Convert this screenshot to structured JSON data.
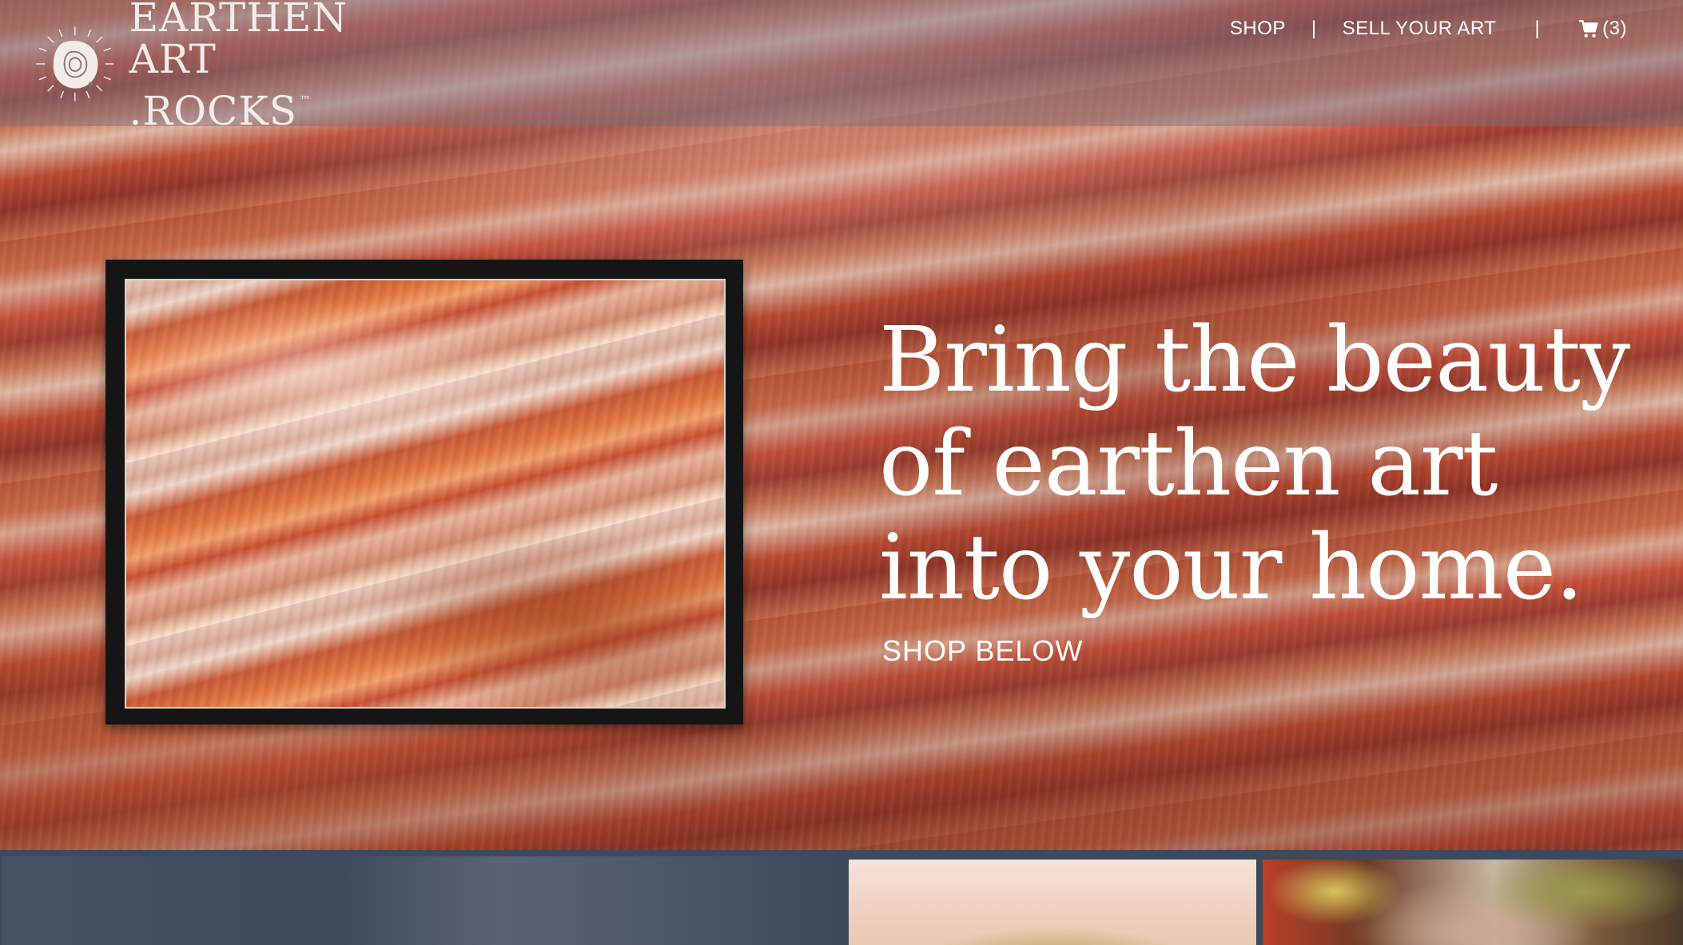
{
  "brand": {
    "line1": "EARTHEN ART",
    "line2": ".ROCKS",
    "trademark": "™",
    "icon": "geode-sun-icon"
  },
  "nav": {
    "shop": "SHOP",
    "separator": "|",
    "sell": "SELL YOUR ART",
    "cart_icon": "cart-icon",
    "cart_count": "(3)"
  },
  "hero": {
    "headline_line1": "Bring the beauty",
    "headline_line2": "of earthen art",
    "headline_line3": "into your home.",
    "cta": "SHOP BELOW"
  },
  "colors": {
    "text": "#ffffff",
    "header_overlay": "#786e82",
    "frame": "#151515",
    "bottom_strip": "#3d4a5c"
  }
}
